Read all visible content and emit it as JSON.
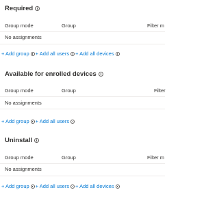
{
  "columns": {
    "group_mode": "Group mode",
    "group": "Group",
    "filter": "Filter m",
    "filter_alt": "Filter"
  },
  "sections": [
    {
      "title": "Required",
      "empty_text": "No assignments",
      "links": {
        "add_group": "+ Add group",
        "add_all_users": "+ Add all users",
        "add_all_devices": "+ Add all devices"
      }
    },
    {
      "title": "Available for enrolled devices",
      "empty_text": "No assignments",
      "links": {
        "add_group": "+ Add group",
        "add_all_users": "+ Add all users"
      }
    },
    {
      "title": "Uninstall",
      "empty_text": "No assignments",
      "links": {
        "add_group": "+ Add group",
        "add_all_users": "+ Add all users",
        "add_all_devices": "+ Add all devices"
      }
    }
  ],
  "colors": {
    "link": "#0078d4",
    "text": "#323130",
    "divider": "#edebe9"
  },
  "icons": {
    "info": "info-circle-icon"
  }
}
